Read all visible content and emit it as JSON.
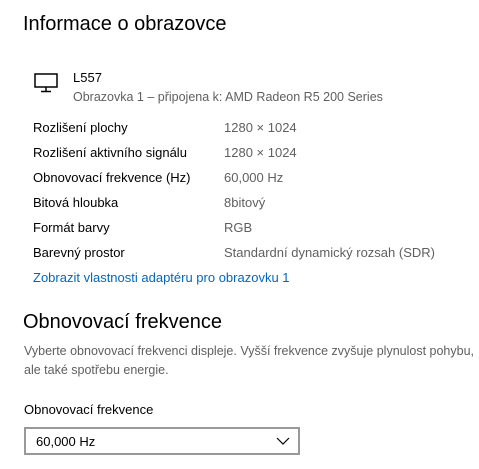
{
  "info_section": {
    "title": "Informace o obrazovce",
    "display": {
      "icon": "monitor-icon",
      "name": "L557",
      "subtitle": "Obrazovka 1 – připojena k: AMD Radeon R5 200 Series"
    },
    "rows": [
      {
        "label": "Rozlišení plochy",
        "value": "1280 × 1024"
      },
      {
        "label": "Rozlišení aktivního signálu",
        "value": "1280 × 1024"
      },
      {
        "label": "Obnovovací frekvence (Hz)",
        "value": "60,000 Hz"
      },
      {
        "label": "Bitová hloubka",
        "value": "8bitový"
      },
      {
        "label": "Formát barvy",
        "value": "RGB"
      },
      {
        "label": "Barevný prostor",
        "value": "Standardní dynamický rozsah (SDR)"
      }
    ],
    "adapter_link": "Zobrazit vlastnosti adaptéru pro obrazovku 1"
  },
  "refresh_section": {
    "title": "Obnovovací frekvence",
    "description": "Vyberte obnovovací frekvenci displeje. Vyšší frekvence zvyšuje plynulost pohybu, ale také spotřebu energie.",
    "dropdown_label": "Obnovovací frekvence",
    "dropdown_value": "60,000 Hz",
    "dropdown_icon": "chevron-down-icon"
  },
  "colors": {
    "link": "#0067c0",
    "secondary_text": "#5f5f5f",
    "dropdown_border": "#999999"
  }
}
